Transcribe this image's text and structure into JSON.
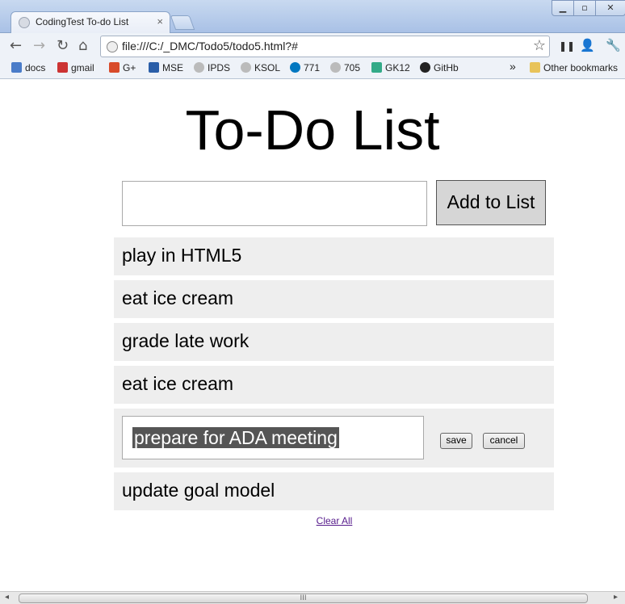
{
  "window": {
    "tab_title": "CodingTest To-do List",
    "tab_close": "×",
    "controls": {
      "minimize": "▁",
      "maximize": "▫",
      "close": "✕"
    }
  },
  "toolbar": {
    "back": "←",
    "forward": "→",
    "reload": "↻",
    "home": "⌂",
    "url": "file:///C:/_DMC/Todo5/todo5.html?#",
    "star": "☆",
    "pause": "❚❚",
    "user": "👤",
    "wrench": "🔧"
  },
  "bookmarks": {
    "items": [
      {
        "label": "docs",
        "icon": "doc-icon",
        "color": "#4a7cc9"
      },
      {
        "label": "gmail",
        "icon": "gmail-icon",
        "color": "#c33"
      },
      {
        "label": "G+",
        "icon": "gplus-icon",
        "color": "#d84b2b"
      },
      {
        "label": "MSE",
        "icon": "z-icon",
        "color": "#2a5ea8"
      },
      {
        "label": "IPDS",
        "icon": "globe-icon",
        "color": "#bbb"
      },
      {
        "label": "KSOL",
        "icon": "globe-icon",
        "color": "#bbb"
      },
      {
        "label": "771",
        "icon": "drupal-icon",
        "color": "#0077c0"
      },
      {
        "label": "705",
        "icon": "globe-icon",
        "color": "#bbb"
      },
      {
        "label": "GK12",
        "icon": "google-icon",
        "color": "#3a8"
      },
      {
        "label": "GitHb",
        "icon": "github-icon",
        "color": "#222"
      }
    ],
    "more": "»",
    "other": "Other bookmarks"
  },
  "page": {
    "heading": "To-Do List",
    "new_task_value": "",
    "add_button": "Add to List",
    "items": [
      {
        "text": "play in HTML5"
      },
      {
        "text": "eat ice cream"
      },
      {
        "text": "grade late work"
      },
      {
        "text": "eat ice cream"
      }
    ],
    "editing": {
      "value": "prepare for ADA meeting",
      "save": "save",
      "cancel": "cancel"
    },
    "last_item": "update goal model",
    "clear_all": "Clear All"
  },
  "scrollbar": {
    "grip": "III",
    "left": "◂",
    "right": "▸"
  }
}
